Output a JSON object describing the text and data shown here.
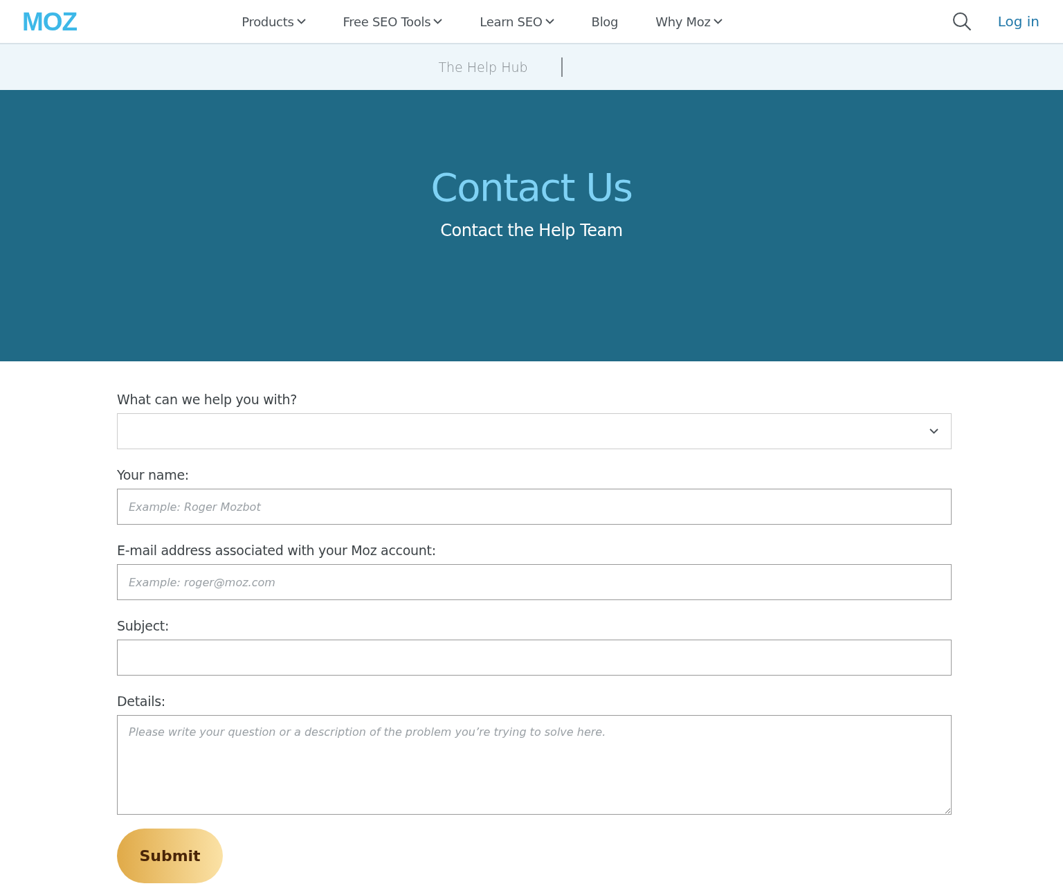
{
  "header": {
    "logo": "MOZ",
    "nav": [
      {
        "label": "Products",
        "has_menu": true
      },
      {
        "label": "Free SEO Tools",
        "has_menu": true
      },
      {
        "label": "Learn SEO",
        "has_menu": true
      },
      {
        "label": "Blog",
        "has_menu": false
      },
      {
        "label": "Why Moz",
        "has_menu": true
      }
    ],
    "login": "Log in"
  },
  "subnav": {
    "items": [
      "The Help Hub"
    ]
  },
  "hero": {
    "title": "Contact Us",
    "subtitle": "Contact the Help Team"
  },
  "form": {
    "fields": [
      {
        "kind": "select",
        "label": "What can we help you with?"
      },
      {
        "kind": "input",
        "label": "Your name:",
        "placeholder": "Example: Roger Mozbot"
      },
      {
        "kind": "input",
        "label": "E-mail address associated with your Moz account:",
        "placeholder": "Example: roger@moz.com"
      },
      {
        "kind": "input",
        "label": "Subject:"
      },
      {
        "kind": "textarea",
        "label": "Details:",
        "placeholder": "Please write your question or a description of the problem you’re trying to solve here."
      }
    ],
    "submit": "Submit"
  }
}
